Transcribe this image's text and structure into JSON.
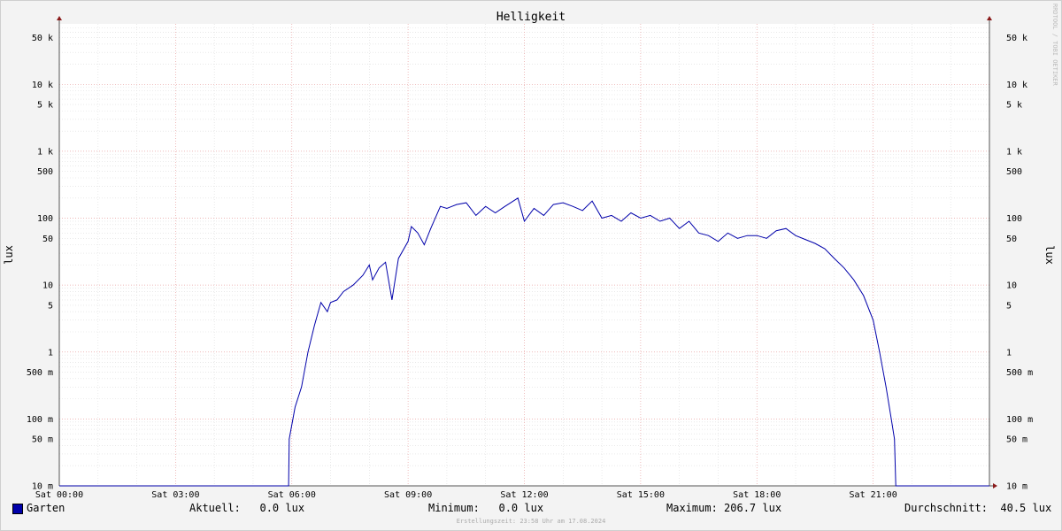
{
  "chart_data": {
    "type": "line",
    "title": "Helligkeit",
    "ylabel": "lux",
    "y_scale": "log",
    "ylim": [
      0.01,
      80000
    ],
    "x_hours": [
      0,
      24
    ],
    "x_ticks": [
      "Sat 00:00",
      "Sat 03:00",
      "Sat 06:00",
      "Sat 09:00",
      "Sat 12:00",
      "Sat 15:00",
      "Sat 18:00",
      "Sat 21:00"
    ],
    "y_ticks": [
      "10 m",
      "50 m",
      "100 m",
      "500 m",
      "1",
      "5",
      "10",
      "50",
      "100",
      "500",
      "1 k",
      "5 k",
      "10 k",
      "50 k"
    ],
    "line_color": "#0000aa",
    "series": [
      {
        "name": "Garten",
        "points": [
          [
            "00:00",
            0.01
          ],
          [
            "05:55",
            0.01
          ],
          [
            "05:56",
            0.05
          ],
          [
            "06:05",
            0.15
          ],
          [
            "06:15",
            0.3
          ],
          [
            "06:25",
            1.0
          ],
          [
            "06:35",
            2.5
          ],
          [
            "06:45",
            5.5
          ],
          [
            "06:55",
            4.0
          ],
          [
            "07:00",
            5.5
          ],
          [
            "07:10",
            6.0
          ],
          [
            "07:20",
            8.0
          ],
          [
            "07:35",
            10.0
          ],
          [
            "07:50",
            14.0
          ],
          [
            "08:00",
            20.0
          ],
          [
            "08:05",
            12.0
          ],
          [
            "08:15",
            18.0
          ],
          [
            "08:25",
            22.0
          ],
          [
            "08:35",
            6.0
          ],
          [
            "08:45",
            25.0
          ],
          [
            "09:00",
            45.0
          ],
          [
            "09:05",
            75.0
          ],
          [
            "09:15",
            60.0
          ],
          [
            "09:25",
            40.0
          ],
          [
            "09:35",
            70.0
          ],
          [
            "09:50",
            150.0
          ],
          [
            "10:00",
            140.0
          ],
          [
            "10:15",
            160.0
          ],
          [
            "10:30",
            170.0
          ],
          [
            "10:45",
            110.0
          ],
          [
            "11:00",
            150.0
          ],
          [
            "11:15",
            120.0
          ],
          [
            "11:30",
            150.0
          ],
          [
            "11:50",
            200.0
          ],
          [
            "12:00",
            90.0
          ],
          [
            "12:15",
            140.0
          ],
          [
            "12:30",
            110.0
          ],
          [
            "12:45",
            160.0
          ],
          [
            "13:00",
            170.0
          ],
          [
            "13:15",
            150.0
          ],
          [
            "13:30",
            130.0
          ],
          [
            "13:45",
            180.0
          ],
          [
            "14:00",
            100.0
          ],
          [
            "14:15",
            110.0
          ],
          [
            "14:30",
            90.0
          ],
          [
            "14:45",
            120.0
          ],
          [
            "15:00",
            100.0
          ],
          [
            "15:15",
            110.0
          ],
          [
            "15:30",
            90.0
          ],
          [
            "15:45",
            100.0
          ],
          [
            "16:00",
            70.0
          ],
          [
            "16:15",
            90.0
          ],
          [
            "16:30",
            60.0
          ],
          [
            "16:45",
            55.0
          ],
          [
            "17:00",
            45.0
          ],
          [
            "17:15",
            60.0
          ],
          [
            "17:30",
            50.0
          ],
          [
            "17:45",
            55.0
          ],
          [
            "18:00",
            55.0
          ],
          [
            "18:15",
            50.0
          ],
          [
            "18:30",
            65.0
          ],
          [
            "18:45",
            70.0
          ],
          [
            "19:00",
            55.0
          ],
          [
            "19:15",
            48.0
          ],
          [
            "19:30",
            42.0
          ],
          [
            "19:45",
            35.0
          ],
          [
            "20:00",
            25.0
          ],
          [
            "20:15",
            18.0
          ],
          [
            "20:30",
            12.0
          ],
          [
            "20:45",
            7.0
          ],
          [
            "21:00",
            3.0
          ],
          [
            "21:10",
            1.0
          ],
          [
            "21:20",
            0.3
          ],
          [
            "21:28",
            0.1
          ],
          [
            "21:33",
            0.05
          ],
          [
            "21:35",
            0.01
          ],
          [
            "24:00",
            0.01
          ]
        ]
      }
    ]
  },
  "legend": {
    "series_label": "Garten",
    "current": "Aktuell:   0.0 lux",
    "minimum": "Minimum:   0.0 lux",
    "maximum": "Maximum: 206.7 lux",
    "average": "Durchschnitt:  40.5 lux"
  },
  "footer": "Erstellungszeit: 23:58 Uhr am 17.08.2024",
  "side_label": "RRDTOOL / TOBI OETIKER"
}
